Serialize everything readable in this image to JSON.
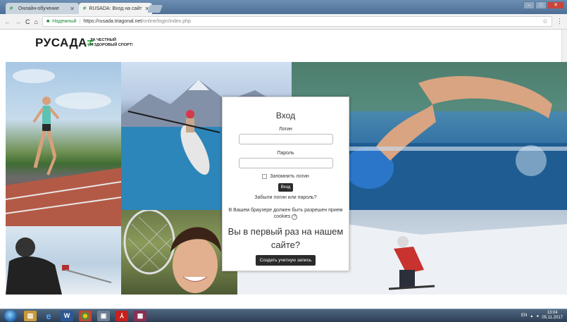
{
  "browser": {
    "tabs": [
      {
        "label": "Онлайн-обучение",
        "active": false
      },
      {
        "label": "RUSADA: Вход на сайт",
        "active": true
      }
    ],
    "secure_label": "Надежный",
    "url_host": "https://rusada.triagonal.net",
    "url_path": "/online/login/index.php"
  },
  "site": {
    "logo_text": "РУСАДА",
    "slogan_line1": "ЗА ЧЕСТНЫЙ",
    "slogan_line2": "И ЗДОРОВЫЙ СПОРТ!"
  },
  "login": {
    "title": "Вход",
    "username_label": "Логин",
    "username_value": "",
    "password_label": "Пароль",
    "password_value": "",
    "remember_label": "Запомнить логин",
    "remember_checked": false,
    "submit_label": "Вход",
    "forgot_link": "Забыли логин или пароль?",
    "cookies_notice": "В Вашем браузере должен быть разрешен прием cookies",
    "first_time_heading": "Вы в первый раз на нашем сайте?",
    "create_account_label": "Создать учетную запись"
  },
  "taskbar": {
    "language": "EN",
    "clock_time": "13:04",
    "clock_date": "05.11.2017"
  },
  "colors": {
    "brand_green": "#35b24a",
    "button_dark": "#2b2b2b",
    "secure_green": "#1e8a3a"
  }
}
